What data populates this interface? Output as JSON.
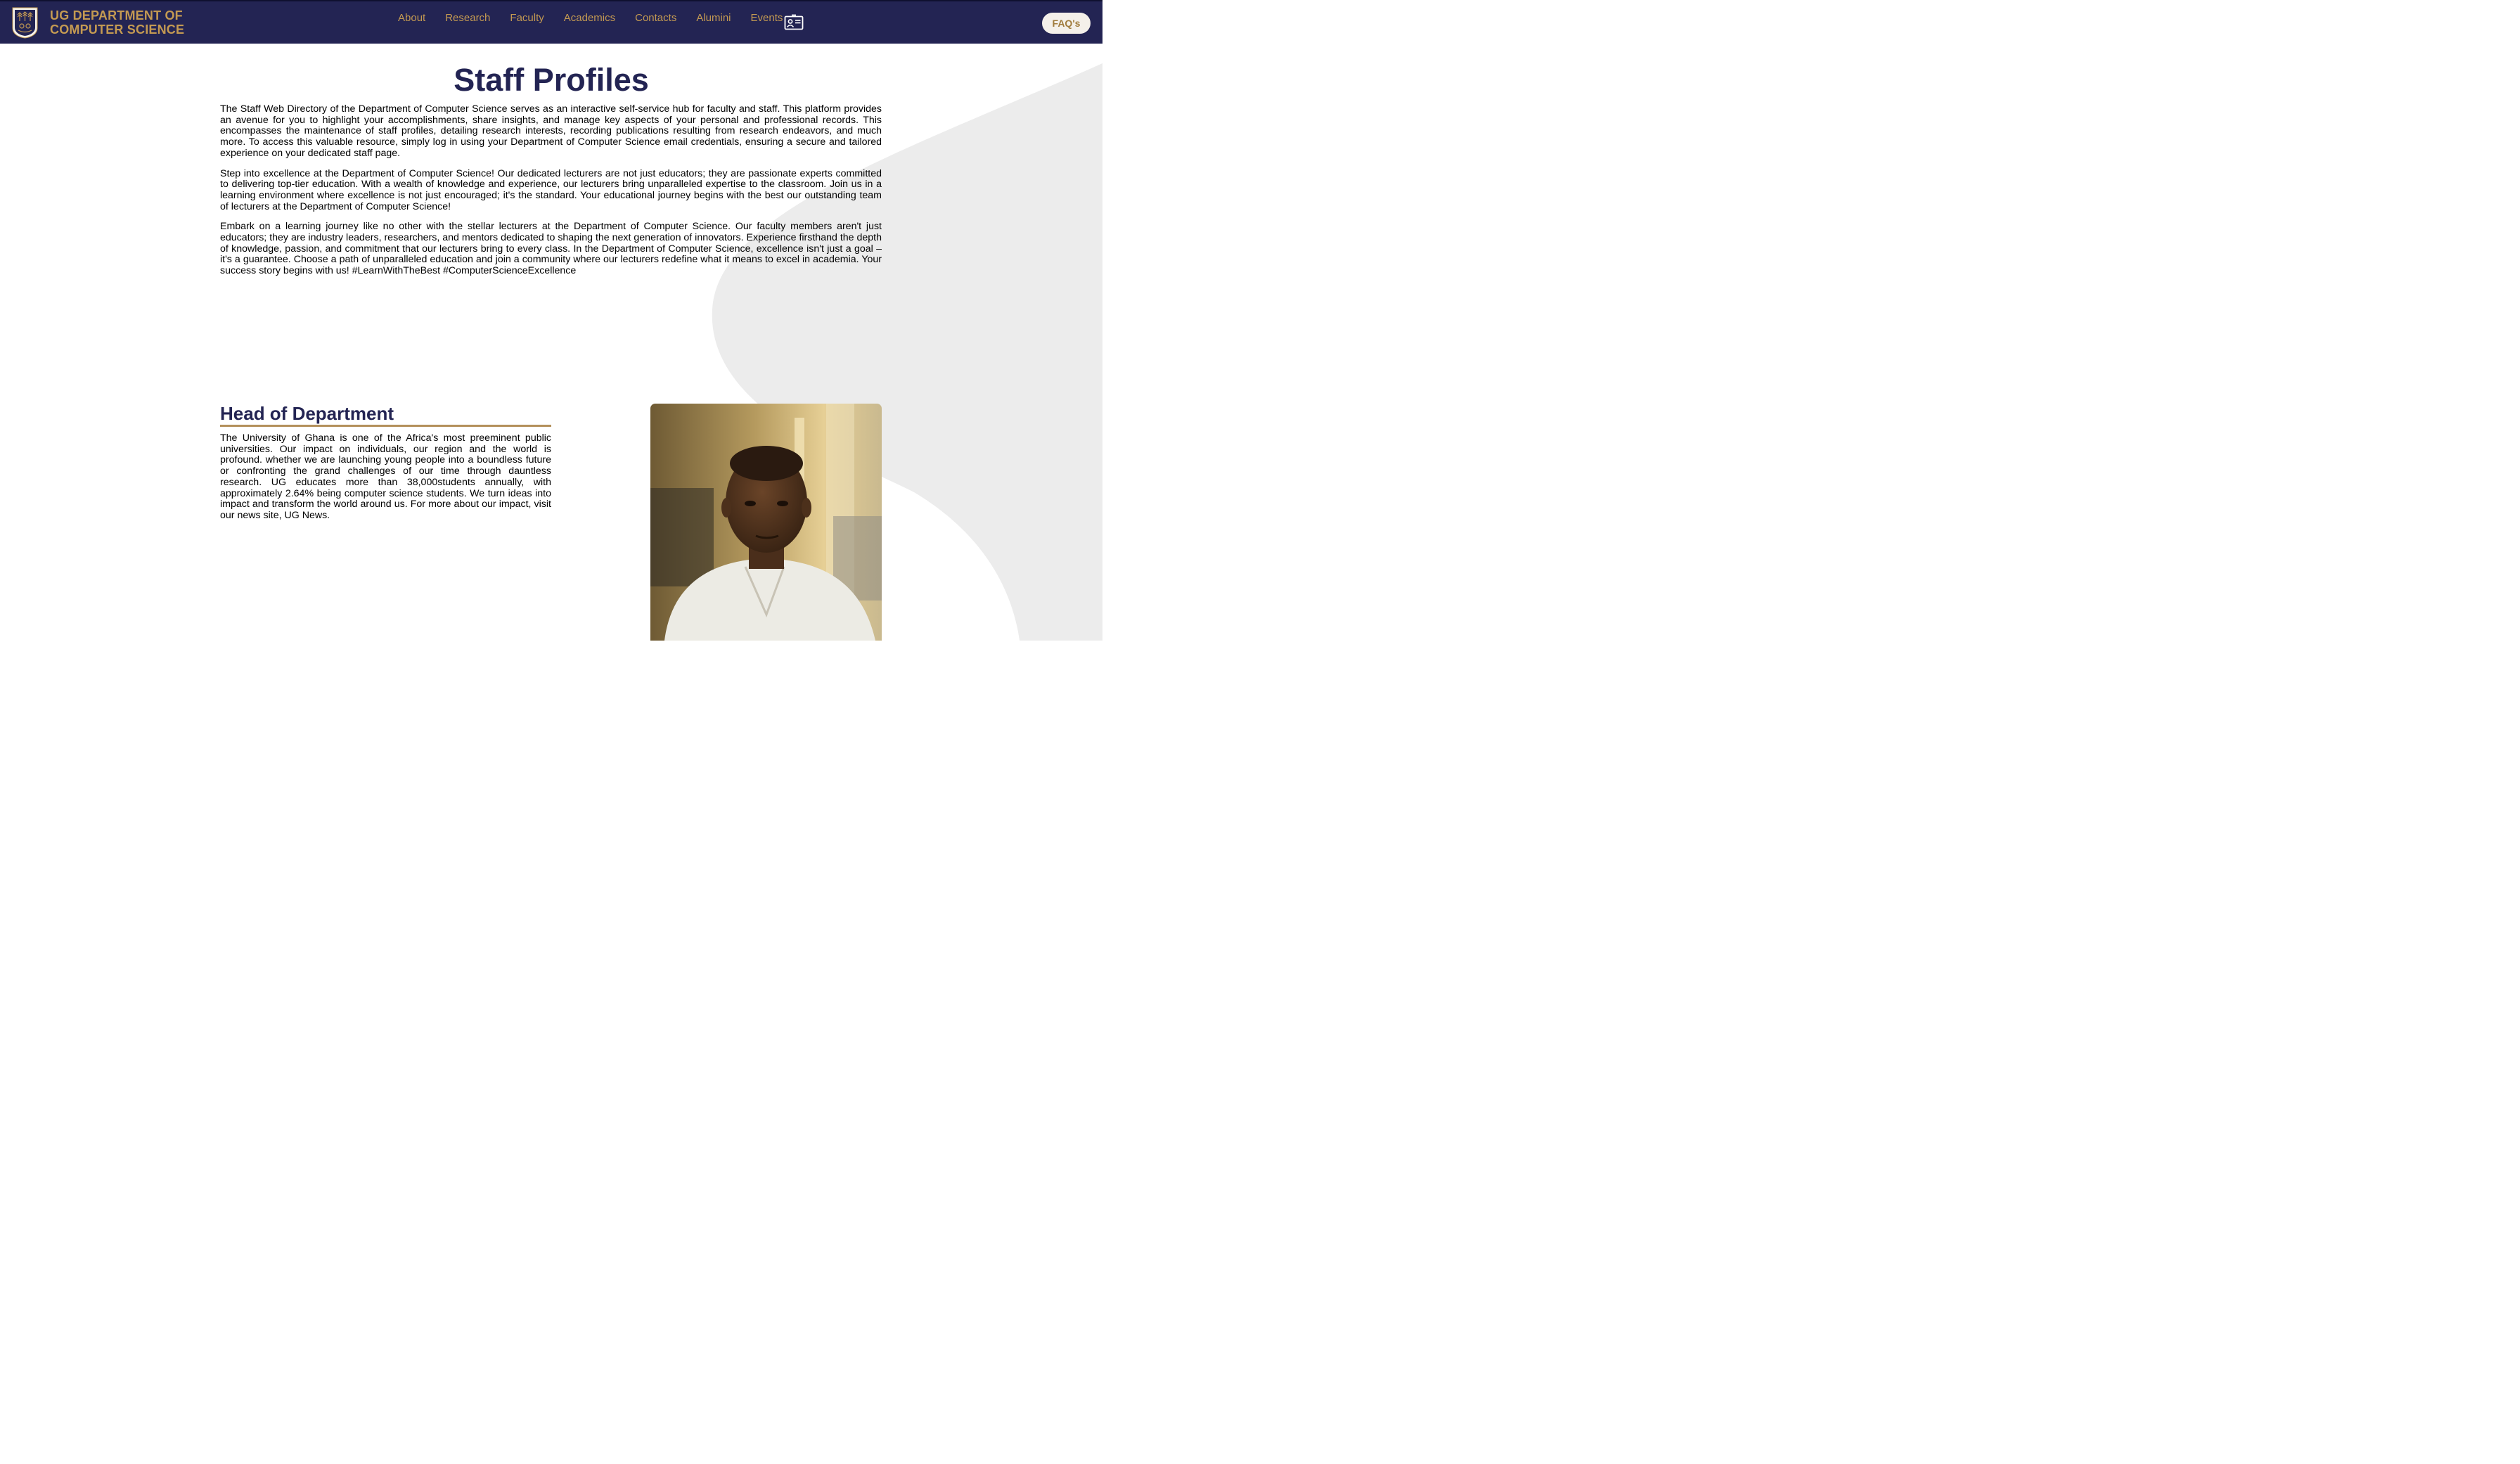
{
  "header": {
    "brand_line1": "UG DEPARTMENT OF",
    "brand_line2": "COMPUTER SCIENCE",
    "nav": [
      "About",
      "Research",
      "Faculty",
      "Academics",
      "Contacts",
      "Alumini",
      "Events"
    ],
    "profile_icon": "id-card-icon",
    "faq_label": "FAQ's"
  },
  "colors": {
    "header_bg": "#232453",
    "accent_gold": "#c49a52",
    "title_navy": "#232453"
  },
  "main": {
    "title": "Staff Profiles",
    "paragraphs": [
      "The Staff Web Directory of the Department of Computer Science serves as an interactive self-service hub for faculty and staff. This platform provides an avenue for you to highlight your accomplishments, share insights, and manage key aspects of your personal and professional records. This encompasses the maintenance of staff profiles, detailing research interests, recording publications resulting from research endeavors, and much more. To access this valuable resource, simply log in using your Department of Computer Science email credentials, ensuring a secure and tailored experience on your dedicated staff page.",
      "Step into excellence at the Department of Computer Science! Our dedicated lecturers are not just educators; they are passionate experts committed to delivering top-tier education. With a wealth of knowledge and experience, our lecturers bring unparalleled expertise to the classroom. Join us in a learning environment where excellence is not just encouraged; it's the standard. Your educational journey begins with the best our outstanding team of lecturers at the Department of Computer Science!",
      "Embark on a learning journey like no other with the stellar lecturers at the Department of Computer Science. Our faculty members aren't just educators; they are industry leaders, researchers, and mentors dedicated to shaping the next generation of innovators. Experience firsthand the depth of knowledge, passion, and commitment that our lecturers bring to every class. In the Department of Computer Science, excellence isn't just a goal – it's a guarantee. Choose a path of unparalleled education and join a community where our lecturers redefine what it means to excel in academia. Your success story begins with us! #LearnWithTheBest #ComputerScienceExcellence"
    ]
  },
  "hod": {
    "title": "Head of Department",
    "text": "The University of Ghana is one of the Africa's most preeminent public universities. Our impact on individuals, our region and the world is profound. whether we are launching young people into a boundless future or confronting the grand challenges of our time through dauntless research. UG educates more than 38,000students annually, with approximately 2.64% being computer science students. We turn ideas into impact and transform the world around us. For more about our impact, visit our news site, UG News."
  }
}
